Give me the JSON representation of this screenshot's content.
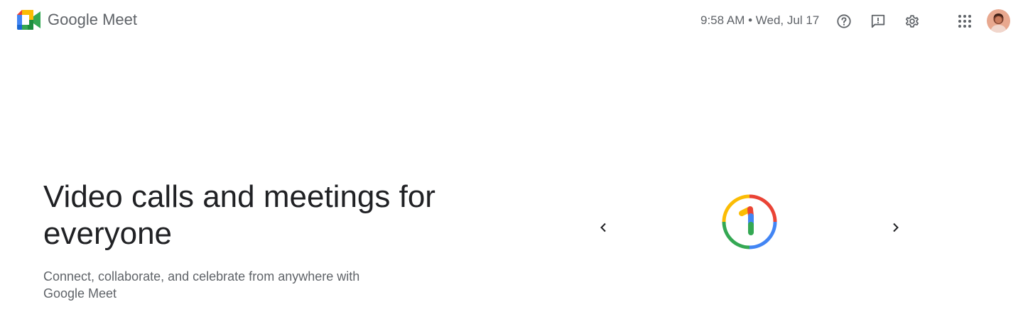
{
  "header": {
    "brand_google": "Google",
    "brand_product": "Meet",
    "datetime": "9:58 AM • Wed, Jul 17",
    "icons": {
      "help": "help-circle-icon",
      "feedback": "feedback-icon",
      "settings": "gear-icon",
      "apps": "apps-grid-icon",
      "account": "avatar"
    }
  },
  "hero": {
    "title": "Video calls and meetings for everyone",
    "subtitle": "Connect, collaborate, and celebrate from anywhere with Google Meet"
  },
  "carousel": {
    "prev_icon": "chevron-left-icon",
    "next_icon": "chevron-right-icon",
    "image_icon": "google-one-icon"
  },
  "colors": {
    "blue": "#4285f4",
    "red": "#ea4335",
    "yellow": "#fbbc04",
    "green": "#34a853",
    "text_primary": "#202124",
    "text_secondary": "#5f6368"
  }
}
